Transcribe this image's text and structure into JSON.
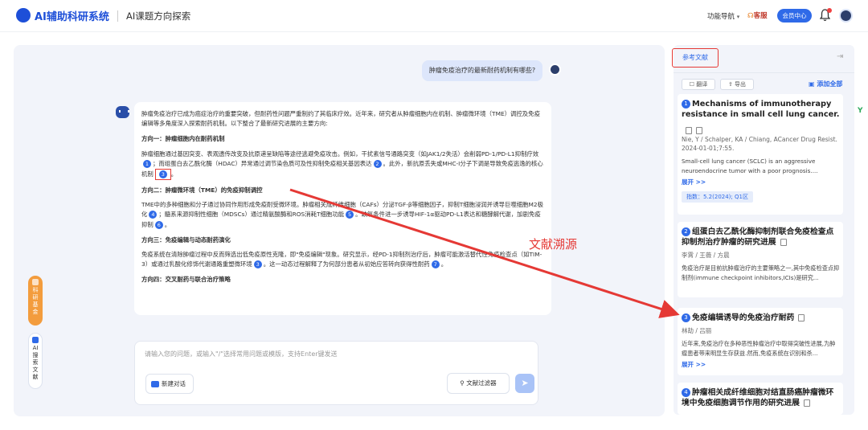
{
  "header": {
    "app_name": "AI辅助科研系统",
    "subtitle": "AI课题方向探索",
    "nav_label": "功能导航",
    "service_label": "客服",
    "member_label": "会员中心"
  },
  "chat": {
    "question": "肿瘤免疫治疗的最新耐药机制有哪些?",
    "intro": "肿瘤免疫治疗已成为癌症治疗的重要突破，但耐药性问题严重制约了其临床疗效。近年来，研究者从肿瘤细胞内在机制、肿瘤微环境（TME）调控及免疫编辑等多角度深入探索耐药机制。以下整合了最新研究进展的主要方向:",
    "s1_title": "方向一：肿瘤细胞内在耐药机制",
    "s1_a": "肿瘤细胞通过基因突变、表观遗传改变及抗原递呈缺陷等途径逃避免疫攻击。例如，干扰素信号通路突变（如JAK1/2失活）会削弱PD-1/PD-L1抑制疗效",
    "s1_b": "；而组蛋白去乙酰化酶（HDAC）异常通过调节染色质可及性抑制免疫相关基因表达",
    "s1_c": "。此外，新抗原丢失或MHC-I分子下调是导致免疫逃逸的核心机制",
    "s2_title": "方向二：肿瘤微环境（TME）的免疫抑制调控",
    "s2_a": "TME中的多种细胞和分子通过协同作用形成免疫耐受微环境。肿瘤相关成纤维细胞（CAFs）分泌TGF-β等细胞因子，抑制T细胞浸润并诱导巨噬细胞M2极化",
    "s2_b": "；髓系来源抑制性细胞（MDSCs）通过精氨酸酶和ROS消耗T细胞功能",
    "s2_c": "。缺氧条件进一步诱导HIF-1α驱动PD-L1表达和糖酵解代谢，加剧免疫抑制",
    "s3_title": "方向三：免疫编辑与动态耐药演化",
    "s3_a": "免疫系统在清除肿瘤过程中反而筛选出低免疫原性克隆，即\"免疫编辑\"现象。研究显示，经PD-1抑制剂治疗后，肿瘤可能激活替代性免疫检查点（如TIM-3）或通过乳酸化修饰代谢通路重塑微环境",
    "s3_b": "。这一动态过程解释了为何部分患者从初始应答转向获得性耐药",
    "s4_title": "方向四：交叉耐药与联合治疗策略",
    "cites": [
      "1",
      "2",
      "3",
      "4",
      "5",
      "6",
      "3",
      "7"
    ]
  },
  "side": {
    "pill1": [
      "科",
      "研",
      "基",
      "金"
    ],
    "pill2": [
      "AI",
      "搜",
      "索",
      "文",
      "献"
    ]
  },
  "input": {
    "placeholder": "请输入您的问题，或输入\"/\"选择常用问题或模版，支持Enter键发送",
    "new_chat": "新建对话",
    "filter": "文献过滤器"
  },
  "refs": {
    "title": "参考文献",
    "translate": "翻译",
    "export": "导出",
    "add_all": "添加全部",
    "more": "展开 >>",
    "items": [
      {
        "num": "1",
        "title": "Mechanisms of immunotherapy resistance in small cell lung cancer.",
        "authors": "Nie, Y / Schalper, KA / Chiang, ACancer Drug Resist.",
        "date": "2024-01-01;7:55.",
        "abstract": "Small-cell lung cancer (SCLC) is an aggressive neuroendocrine tumor with a poor prognosis....",
        "index": "指数：5.2(2024); Q1区"
      },
      {
        "num": "2",
        "title": "组蛋白去乙酰化酶抑制剂联合免疫检查点抑制剂治疗肿瘤的研究进展",
        "authors": "李霄 / 王薇 / 方晨",
        "abstract": "免疫治疗是目前抗肿瘤治疗的主要策略之一,其中免疫检查点抑制剂(immune checkpoint inhibitors,ICIs)是研究..."
      },
      {
        "num": "3",
        "title": "免疫编辑诱导的免疫治疗耐药",
        "authors": "林劼 / 吕丽",
        "abstract": "近年来,免疫治疗在多种恶性肿瘤治疗中取得突破性进展,为肿瘤患者带来明显生存获益.然而,免疫系统在识别和杀..."
      },
      {
        "num": "4",
        "title": "肿瘤相关成纤维细胞对结直肠癌肿瘤微环境中免疫细胞调节作用的研究进展"
      }
    ]
  },
  "annotation": {
    "label": "文献溯源",
    "color": "#e53935"
  },
  "colors": {
    "accent": "#2f6ae8",
    "panel_bg": "#f2f4fa",
    "highlight": "#e53935"
  }
}
